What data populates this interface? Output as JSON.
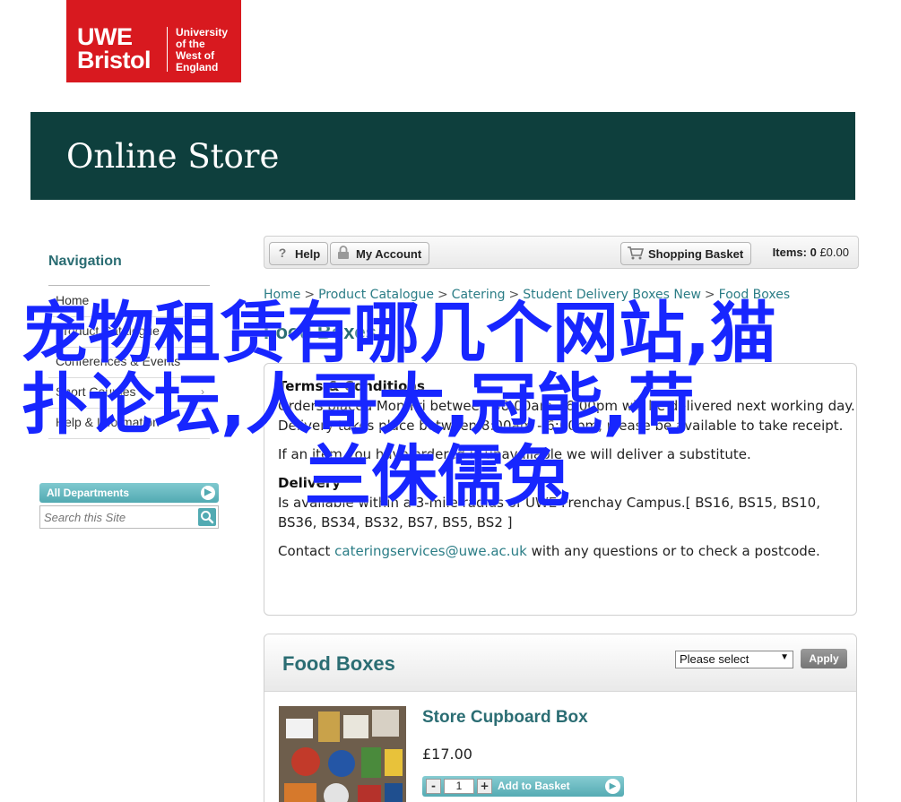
{
  "logo": {
    "primary": [
      "UWE",
      "Bristol"
    ],
    "secondary": [
      "University",
      "of the",
      "West of",
      "England"
    ]
  },
  "banner": {
    "title": "Online Store"
  },
  "sidebar": {
    "heading": "Navigation",
    "items": [
      {
        "label": "Home"
      },
      {
        "label": "Product Catalogue"
      },
      {
        "label": "Conferences & Events"
      },
      {
        "label": "Short Courses"
      },
      {
        "label": "Help & Information"
      }
    ],
    "departments_label": "All Departments",
    "search_placeholder": "Search this Site"
  },
  "toolbar": {
    "help": "Help",
    "account": "My Account",
    "basket": "Shopping Basket",
    "items_label": "Items:",
    "items_count": "0",
    "items_total": "£0.00"
  },
  "breadcrumb": [
    "Home",
    "Product Catalogue",
    "Catering",
    "Student Delivery Boxes New",
    "Food Boxes"
  ],
  "page_title": "Food Boxes",
  "info": {
    "terms_heading": "Terms & Conditions",
    "terms_text": "Orders placed Mon-Fri between 08:00am - 6:00pm will be delivered next working day. Delivery takes place between 8:00am - 6:00pm, please be available to take receipt.",
    "substitute_text": "If an item you have ordered is unavailable we will deliver a substitute.",
    "delivery_heading": "Delivery",
    "delivery_text": "Is available within a 3-mile radius of UWE Frenchay Campus.[ BS16, BS15, BS10, BS36, BS34, BS32, BS7, BS5, BS2 ]",
    "contact_prefix": "Contact",
    "contact_email": "cateringservices@uwe.ac.uk",
    "contact_suffix": "with any questions or to check a postcode."
  },
  "food_boxes": {
    "title": "Food Boxes",
    "select_value": "Please select",
    "apply_label": "Apply",
    "product": {
      "name": "Store Cupboard Box",
      "price": "£17.00",
      "quantity": "1",
      "add_label": "Add to Basket"
    }
  },
  "overlay": {
    "line1": "宠物租赁有哪几个网站,猫",
    "line2": "扑论坛,人哥大,冠能,荷",
    "line3": "兰侏儒兔"
  },
  "colors": {
    "brand_red": "#d8191f",
    "banner": "#0e3f3d",
    "accent": "#2b6d73",
    "link": "#2b7d86",
    "overlay_text": "#1726ff"
  }
}
